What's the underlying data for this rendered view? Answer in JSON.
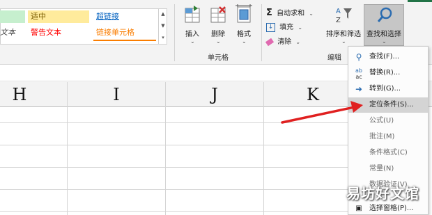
{
  "cell_styles": {
    "partial_style": "文本",
    "neutral": "适中",
    "hyperlink": "超链接",
    "warning": "警告文本",
    "linked_cell": "链接单元格"
  },
  "cells_group": {
    "insert": "插入",
    "delete": "删除",
    "format": "格式",
    "label": "单元格"
  },
  "editing_group": {
    "autosum": "自动求和",
    "fill": "填充",
    "clear": "清除",
    "sort_filter": "排序和筛选",
    "find_select": "查找和选择",
    "label": "编辑"
  },
  "columns": [
    "H",
    "I",
    "J",
    "K"
  ],
  "find_menu": {
    "items": [
      {
        "label": "查找(F)...",
        "icon": "search-icon"
      },
      {
        "label": "替换(R)...",
        "icon": "replace-icon"
      },
      {
        "label": "转到(G)...",
        "icon": "arrow-right-icon"
      },
      {
        "label": "定位条件(S)...",
        "icon": "none"
      },
      {
        "label": "公式(U)",
        "icon": "none"
      },
      {
        "label": "批注(M)",
        "icon": "none"
      },
      {
        "label": "条件格式(C)",
        "icon": "none"
      },
      {
        "label": "常量(N)",
        "icon": "none"
      },
      {
        "label": "数据验证(V)",
        "icon": "none"
      },
      {
        "label": "选择窗格(P)...",
        "icon": "selection-pane-icon"
      }
    ],
    "highlighted_index": 3
  },
  "watermark": "易坊好文馆",
  "colors": {
    "neutral_fill": "#ffeb9c",
    "good_fill": "#c6efce",
    "warning_text": "#ff0000",
    "hyperlink_text": "#0563c1",
    "linked_cell_text": "#fa7d00",
    "menu_highlight": "#d4d4d4",
    "arrow": "#e02020",
    "find_icon_blue": "#2b6cb0"
  }
}
